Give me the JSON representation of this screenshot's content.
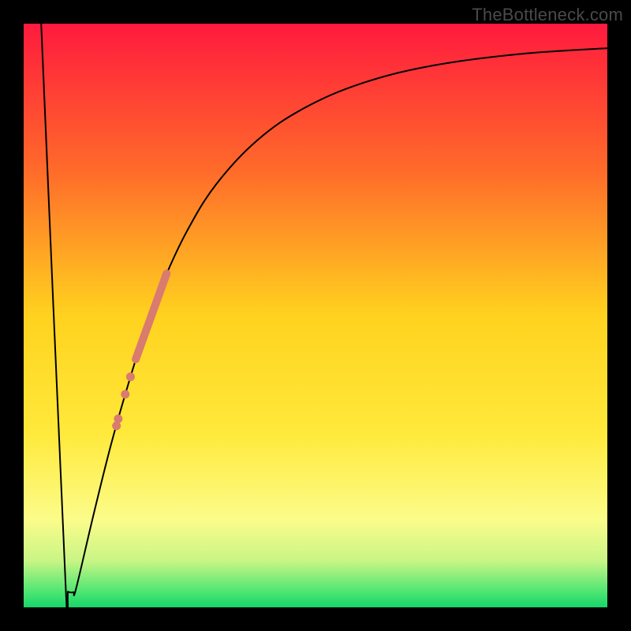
{
  "watermark": "TheBottleneck.com",
  "chart_data": {
    "type": "line",
    "title": "",
    "xlabel": "",
    "ylabel": "",
    "xlim": [
      0,
      100
    ],
    "ylim": [
      0,
      100
    ],
    "gradient_stops": [
      {
        "offset": 0.0,
        "color": "#ff1a3e"
      },
      {
        "offset": 0.25,
        "color": "#ff6a2a"
      },
      {
        "offset": 0.5,
        "color": "#ffd21f"
      },
      {
        "offset": 0.7,
        "color": "#ffe93a"
      },
      {
        "offset": 0.85,
        "color": "#fbfc8a"
      },
      {
        "offset": 0.92,
        "color": "#c9f585"
      },
      {
        "offset": 0.975,
        "color": "#4ae572"
      },
      {
        "offset": 1.0,
        "color": "#16d66a"
      }
    ],
    "series": [
      {
        "name": "bottleneck-curve",
        "type": "line",
        "color": "#000000",
        "width": 2,
        "points": [
          {
            "x": 3.0,
            "y": 100.0
          },
          {
            "x": 7.2,
            "y": 3.5
          },
          {
            "x": 7.6,
            "y": 2.7
          },
          {
            "x": 8.5,
            "y": 2.6
          },
          {
            "x": 9.0,
            "y": 3.3
          },
          {
            "x": 12.0,
            "y": 16.0
          },
          {
            "x": 15.0,
            "y": 28.0
          },
          {
            "x": 18.0,
            "y": 38.5
          },
          {
            "x": 21.0,
            "y": 48.0
          },
          {
            "x": 24.0,
            "y": 56.0
          },
          {
            "x": 28.0,
            "y": 64.5
          },
          {
            "x": 33.0,
            "y": 72.5
          },
          {
            "x": 40.0,
            "y": 80.0
          },
          {
            "x": 48.0,
            "y": 85.5
          },
          {
            "x": 58.0,
            "y": 89.8
          },
          {
            "x": 70.0,
            "y": 92.8
          },
          {
            "x": 85.0,
            "y": 94.8
          },
          {
            "x": 100.0,
            "y": 95.8
          }
        ]
      },
      {
        "name": "highlight-segment",
        "type": "line",
        "color": "#d97b6e",
        "width": 10,
        "cap": "round",
        "points": [
          {
            "x": 19.2,
            "y": 42.5
          },
          {
            "x": 24.5,
            "y": 57.2
          }
        ]
      },
      {
        "name": "highlight-dots",
        "type": "scatter",
        "color": "#d97b6e",
        "radius": 5.5,
        "points": [
          {
            "x": 18.3,
            "y": 39.5
          },
          {
            "x": 17.4,
            "y": 36.5
          },
          {
            "x": 16.2,
            "y": 32.3
          },
          {
            "x": 15.9,
            "y": 31.1
          }
        ]
      }
    ]
  }
}
